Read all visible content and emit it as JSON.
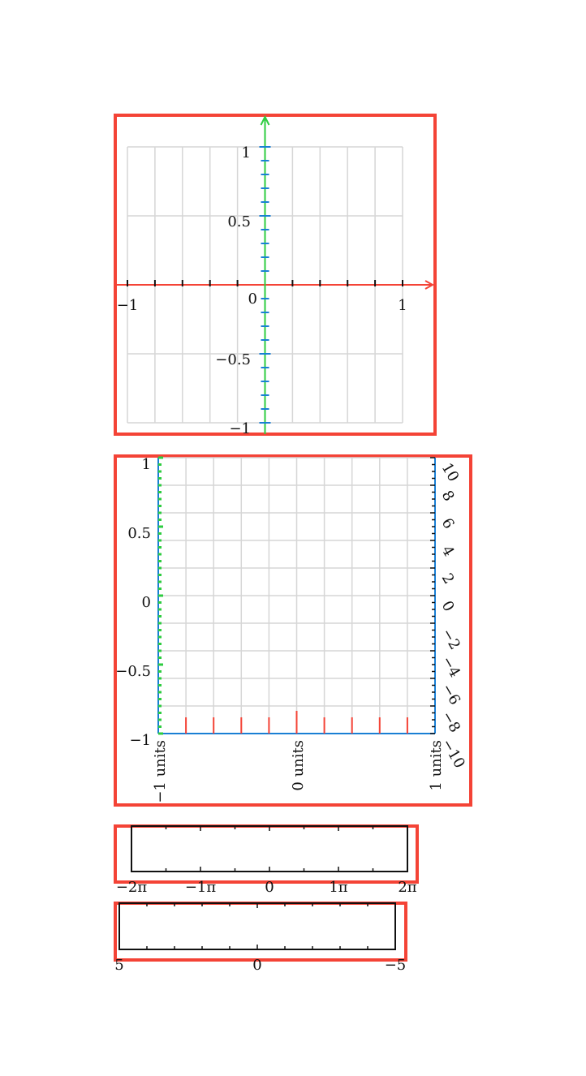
{
  "colors": {
    "frame": "#f44336",
    "grid": "#d6d6d6",
    "axis_x": "#f44336",
    "axis_y": "#2ecc40",
    "ticks_blue": "#1a7fd4",
    "ticks_red": "#f44336",
    "ticks_green": "#2ecc40",
    "black": "#111111"
  },
  "chart_data": [
    {
      "type": "line",
      "title": "",
      "xlim": [
        -1.1,
        1.1
      ],
      "ylim": [
        -1.1,
        1.1
      ],
      "grid": true,
      "x_ticks": [
        -1,
        1
      ],
      "x_tick_labels": [
        "−1",
        "1"
      ],
      "x_minor_ticks": [
        -0.8,
        -0.6,
        -0.4,
        -0.2,
        0.2,
        0.4,
        0.6,
        0.8
      ],
      "y_ticks": [
        -1,
        -0.5,
        0,
        0.5,
        1
      ],
      "y_tick_labels": [
        "−1",
        "−0.5",
        "0",
        "0.5",
        "1"
      ],
      "series": []
    },
    {
      "type": "line",
      "title": "",
      "xlim": [
        -1,
        1
      ],
      "ylim": [
        -1,
        1
      ],
      "grid": true,
      "y_ticks": [
        -1,
        -0.5,
        0,
        0.5,
        1
      ],
      "y_tick_labels": [
        "−1",
        "−0.5",
        "0",
        "0.5",
        "1"
      ],
      "x_ticks": [
        -1,
        0,
        1
      ],
      "x_tick_labels": [
        "−1 units",
        "0 units",
        "1 units"
      ],
      "x_minor_ticks": [
        -0.8,
        -0.6,
        -0.4,
        -0.2,
        0.2,
        0.4,
        0.6,
        0.8
      ],
      "right_axis": {
        "lim": [
          -10,
          10
        ],
        "ticks": [
          10,
          8,
          6,
          4,
          2,
          0,
          -2,
          -4,
          -6,
          -8,
          -10
        ],
        "tick_labels": [
          "10",
          "8",
          "6",
          "4",
          "2",
          "0",
          "−2",
          "−4",
          "−6",
          "−8",
          "−10"
        ]
      },
      "series": []
    },
    {
      "type": "line",
      "title": "",
      "xlim": [
        -6.2832,
        6.2832
      ],
      "grid": false,
      "x_ticks": [
        -6.2832,
        -3.1416,
        0,
        3.1416,
        6.2832
      ],
      "x_tick_labels": [
        "−2π",
        "−1π",
        "0",
        "1π",
        "2π"
      ],
      "series": []
    },
    {
      "type": "line",
      "title": "",
      "xlim": [
        5,
        -5
      ],
      "grid": false,
      "x_ticks": [
        5,
        0,
        -5
      ],
      "x_tick_labels": [
        "5",
        "0",
        "−5"
      ],
      "series": []
    }
  ]
}
